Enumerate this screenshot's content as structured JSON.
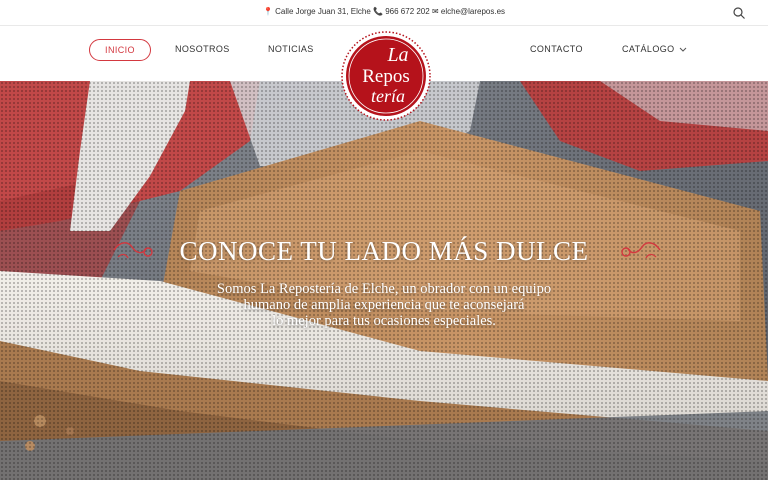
{
  "topbar": {
    "address": "Calle Jorge Juan 31, Elche",
    "phone": "966 672 202",
    "email": "elche@larepos.es"
  },
  "nav": {
    "inicio": "INICIO",
    "nosotros": "NOSOTROS",
    "noticias": "NOTICIAS",
    "contacto": "CONTACTO",
    "catalogo": "CATÁLOGO"
  },
  "logo": {
    "line1": "La",
    "line2": "Repos",
    "line3": "tería"
  },
  "hero": {
    "title": "CONOCE TU LADO MÁS DULCE",
    "line1": "Somos La Repostería de Elche, un obrador con un equipo",
    "line2": "humano de amplia experiencia que te aconsejará",
    "line3": "lo mejor para tus ocasiones especiales."
  },
  "colors": {
    "brand_red": "#d3383f",
    "logo_red": "#b5121b"
  }
}
